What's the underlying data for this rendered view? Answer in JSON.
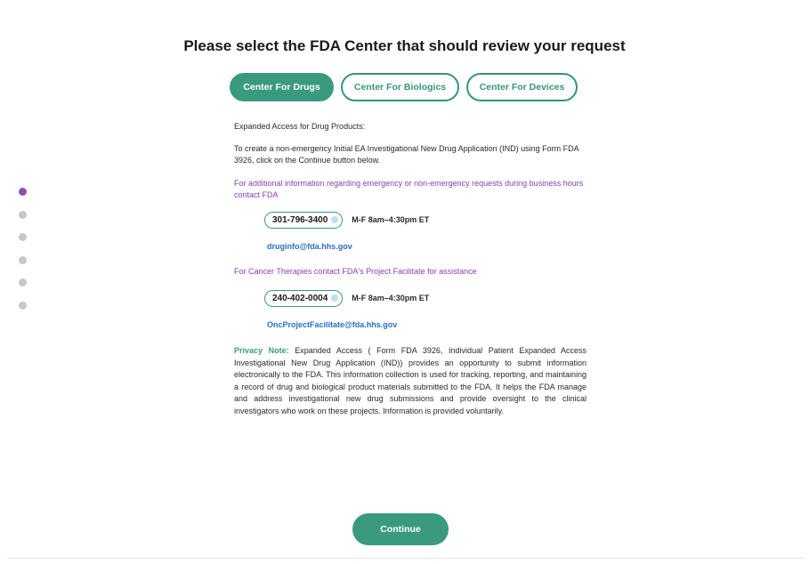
{
  "page": {
    "title": "Please select the FDA Center that should review your request"
  },
  "tabs": [
    {
      "label": "Center For Drugs",
      "active": true
    },
    {
      "label": "Center For Biologics",
      "active": false
    },
    {
      "label": "Center For Devices",
      "active": false
    }
  ],
  "step_indicator": {
    "count": 6,
    "active_index": 0
  },
  "content": {
    "heading": "Expanded Access for Drug Products:",
    "intro": "To create a non-emergency Initial EA Investigational New Drug Application (IND) using Form FDA 3926, click on the Continue button below.",
    "info_line": "For additional information regarding emergency or non-emergency requests during business hours contact FDA",
    "contact1": {
      "phone": "301-796-3400",
      "hours": "M-F 8am–4:30pm ET",
      "email": "druginfo@fda.hhs.gov"
    },
    "cancer_line": "For Cancer Therapies contact FDA's Project Facilitate for assistance",
    "contact2": {
      "phone": "240-402-0004",
      "hours": "M-F 8am–4:30pm ET",
      "email": "OncProjectFacilitate@fda.hhs.gov"
    },
    "privacy_label": "Privacy Note:",
    "privacy_text": " Expanded Access ( Form FDA 3926, Individual Patient Expanded Access Investigational New Drug Application (IND)) provides an opportunity to submit information electronically to the FDA. This information collection is used for tracking, reporting, and maintaining a record of drug and biological product materials submitted to the FDA. It helps the FDA manage and address investigational new drug submissions and provide oversight to the clinical investigators who work on these projects. Information is provided voluntarily."
  },
  "continue_label": "Continue",
  "colors": {
    "accent": "#3a9a7e",
    "purple": "#8a3fb0",
    "link": "#2a6ec0",
    "dot_active": "#8e52b8",
    "dot_inactive": "#c6c6cb"
  },
  "icons": {
    "phone_pill_icon": "phone-icon"
  }
}
